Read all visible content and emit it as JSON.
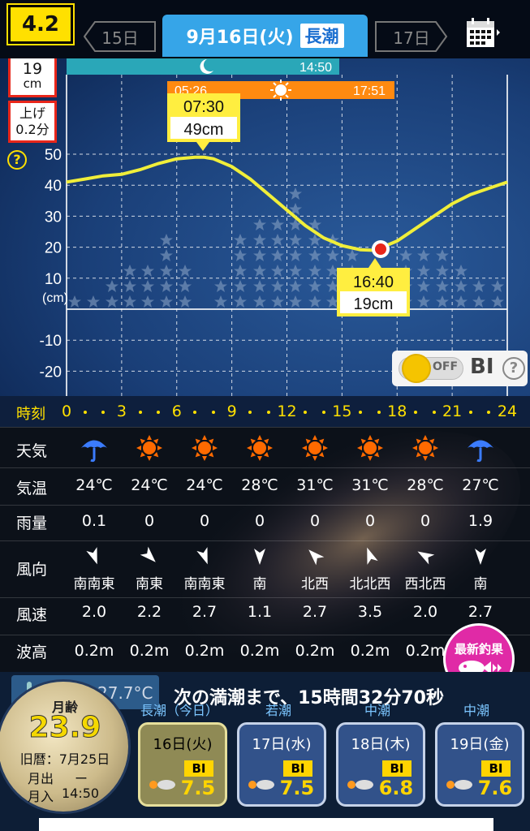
{
  "header": {
    "version": "4.2",
    "prev_day": "15日",
    "next_day": "17日",
    "date": "9月16日(火)",
    "tide_type": "長潮"
  },
  "chart": {
    "cur_height": "19",
    "cur_unit": "cm",
    "trend": "上げ",
    "trend_val": "0.2分",
    "help": "?",
    "moon_time": "14:50",
    "sunrise": "05:26",
    "sunset": "17:51",
    "high_time": "07:30",
    "high_val": "49cm",
    "low_time": "16:40",
    "low_val": "19cm",
    "y_ticks": [
      "50",
      "40",
      "30",
      "20",
      "10",
      "-10",
      "-20"
    ],
    "y_unit": "(cm)",
    "bi_toggle": "OFF",
    "bi_label": "BI",
    "bi_help": "?"
  },
  "chart_data": {
    "type": "line",
    "xlabel": "時刻",
    "ylabel": "(cm)",
    "xlim": [
      0,
      24
    ],
    "ylim": [
      -25,
      60
    ],
    "x_ticks": [
      "0",
      "3",
      "6",
      "9",
      "12",
      "15",
      "18",
      "21",
      "24"
    ],
    "x": [
      0,
      1,
      2,
      3,
      4,
      5,
      6,
      7,
      7.5,
      8,
      9,
      10,
      11,
      12,
      13,
      14,
      15,
      16,
      16.67,
      17,
      18,
      19,
      20,
      21,
      22,
      23,
      24
    ],
    "y": [
      41,
      42,
      43,
      43.5,
      45,
      47,
      48.5,
      49,
      49,
      48.5,
      46,
      42,
      37,
      32,
      27,
      23,
      20.5,
      19.2,
      19,
      19.5,
      22,
      26,
      30,
      34,
      37,
      39,
      41
    ],
    "annotations": [
      {
        "x": 7.5,
        "y": 49,
        "label": "07:30 49cm"
      },
      {
        "x": 16.67,
        "y": 19,
        "label": "16:40 19cm"
      }
    ]
  },
  "time_axis": {
    "label": "時刻",
    "ticks": [
      "0",
      "3",
      "6",
      "9",
      "12",
      "15",
      "18",
      "21",
      "24"
    ]
  },
  "weather": {
    "labels": {
      "sky": "天気",
      "temp": "気温",
      "rain": "雨量",
      "wind_dir": "風向",
      "wind_speed": "風速",
      "wave": "波高"
    },
    "sky": [
      "umbrella",
      "sun",
      "sun",
      "sun",
      "sun",
      "sun",
      "sun",
      "umbrella"
    ],
    "temp": [
      "24℃",
      "24℃",
      "24℃",
      "28℃",
      "31℃",
      "31℃",
      "28℃",
      "27℃"
    ],
    "rain": [
      "0.1",
      "0",
      "0",
      "0",
      "0",
      "0",
      "0",
      "1.9"
    ],
    "wind_arrow_deg": [
      160,
      135,
      160,
      180,
      315,
      340,
      300,
      180
    ],
    "wind_dir": [
      "南南東",
      "南東",
      "南南東",
      "南",
      "北西",
      "北北西",
      "西北西",
      "南"
    ],
    "wind_speed": [
      "2.0",
      "2.2",
      "2.7",
      "1.1",
      "2.7",
      "3.5",
      "2.0",
      "2.7"
    ],
    "wave": [
      "0.2m",
      "0.2m",
      "0.2m",
      "0.2m",
      "0.2m",
      "0.2m",
      "0.2m",
      ""
    ]
  },
  "promo": {
    "label": "最新釣果"
  },
  "bottom": {
    "water_temp": "27.7°C",
    "countdown": "次の満潮まで、15時間32分70秒",
    "moon_age_label": "月齢",
    "moon_age": "23.9",
    "lunar_date": "旧暦：7月25日",
    "moonrise_label": "月出",
    "moonrise": "ー",
    "moonset_label": "月入",
    "moonset": "14:50",
    "days": [
      {
        "tide": "長潮（今日）",
        "date": "16日(火)",
        "bi": "BI",
        "value": "7.5"
      },
      {
        "tide": "若潮",
        "date": "17日(水)",
        "bi": "BI",
        "value": "7.5"
      },
      {
        "tide": "中潮",
        "date": "18日(木)",
        "bi": "BI",
        "value": "6.8"
      },
      {
        "tide": "中潮",
        "date": "19日(金)",
        "bi": "BI",
        "value": "7.6"
      }
    ]
  },
  "colors": {
    "accent": "#36a5e8",
    "curve": "#f0ee3a",
    "high_low_box": "#ffee40",
    "sunbar": "#ff8a10",
    "moonbar": "#2aa7b8"
  }
}
